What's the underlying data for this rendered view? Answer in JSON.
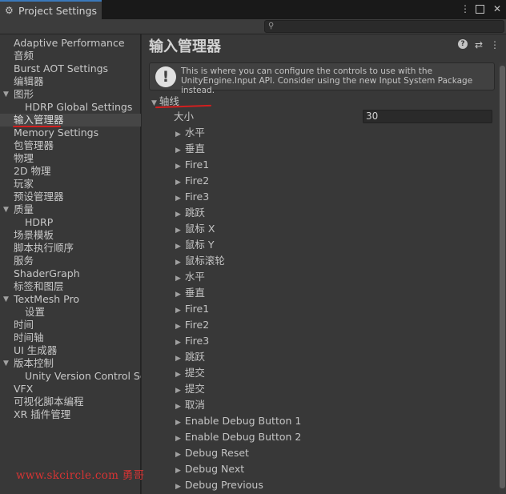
{
  "window": {
    "tab_title": "Project Settings",
    "tab_icon": "gear-icon",
    "menu_icon": "kebab-menu-icon",
    "maximize_icon": "maximize-icon",
    "close_icon": "close-icon"
  },
  "search": {
    "placeholder": "",
    "icon": "search-icon"
  },
  "sidebar": {
    "items": [
      {
        "label": "Adaptive Performance",
        "indent": 0,
        "fold": ""
      },
      {
        "label": "音频",
        "indent": 0,
        "fold": ""
      },
      {
        "label": "Burst AOT Settings",
        "indent": 0,
        "fold": ""
      },
      {
        "label": "编辑器",
        "indent": 0,
        "fold": ""
      },
      {
        "label": "图形",
        "indent": 0,
        "fold": "open"
      },
      {
        "label": "HDRP Global Settings",
        "indent": 1,
        "fold": ""
      },
      {
        "label": "输入管理器",
        "indent": 0,
        "fold": "",
        "selected": true
      },
      {
        "label": "Memory Settings",
        "indent": 0,
        "fold": ""
      },
      {
        "label": "包管理器",
        "indent": 0,
        "fold": ""
      },
      {
        "label": "物理",
        "indent": 0,
        "fold": ""
      },
      {
        "label": "2D 物理",
        "indent": 0,
        "fold": ""
      },
      {
        "label": "玩家",
        "indent": 0,
        "fold": ""
      },
      {
        "label": "预设管理器",
        "indent": 0,
        "fold": ""
      },
      {
        "label": "质量",
        "indent": 0,
        "fold": "open"
      },
      {
        "label": "HDRP",
        "indent": 1,
        "fold": ""
      },
      {
        "label": "场景模板",
        "indent": 0,
        "fold": ""
      },
      {
        "label": "脚本执行顺序",
        "indent": 0,
        "fold": ""
      },
      {
        "label": "服务",
        "indent": 0,
        "fold": ""
      },
      {
        "label": "ShaderGraph",
        "indent": 0,
        "fold": ""
      },
      {
        "label": "标签和图层",
        "indent": 0,
        "fold": ""
      },
      {
        "label": "TextMesh Pro",
        "indent": 0,
        "fold": "open"
      },
      {
        "label": "设置",
        "indent": 1,
        "fold": ""
      },
      {
        "label": "时间",
        "indent": 0,
        "fold": ""
      },
      {
        "label": "时间轴",
        "indent": 0,
        "fold": ""
      },
      {
        "label": "UI 生成器",
        "indent": 0,
        "fold": ""
      },
      {
        "label": "版本控制",
        "indent": 0,
        "fold": "open"
      },
      {
        "label": "Unity Version Control Settings",
        "indent": 1,
        "fold": ""
      },
      {
        "label": "VFX",
        "indent": 0,
        "fold": ""
      },
      {
        "label": "可视化脚本编程",
        "indent": 0,
        "fold": ""
      },
      {
        "label": "XR 插件管理",
        "indent": 0,
        "fold": ""
      }
    ]
  },
  "main": {
    "title": "输入管理器",
    "help_icon": "help-icon",
    "preset_icon": "preset-icon",
    "menu_icon": "kebab-menu-icon",
    "info_icon": "info-icon",
    "info_text": "This is where you can configure the controls to use with the UnityEngine.Input API. Consider using the new Input System Package instead.",
    "axes_label": "轴线",
    "size_label": "大小",
    "size_value": "30",
    "axes": [
      "水平",
      "垂直",
      "Fire1",
      "Fire2",
      "Fire3",
      "跳跃",
      "鼠标 X",
      "鼠标 Y",
      "鼠标滚轮",
      "水平",
      "垂直",
      "Fire1",
      "Fire2",
      "Fire3",
      "跳跃",
      "提交",
      "提交",
      "取消",
      "Enable Debug Button 1",
      "Enable Debug Button 2",
      "Debug Reset",
      "Debug Next",
      "Debug Previous"
    ]
  },
  "watermark": "www.skcircle.com 勇哥",
  "colors": {
    "accent": "#3a79bb",
    "annotation_red": "#d21f1f",
    "panel_bg": "#383838",
    "selected_bg": "#464646"
  }
}
